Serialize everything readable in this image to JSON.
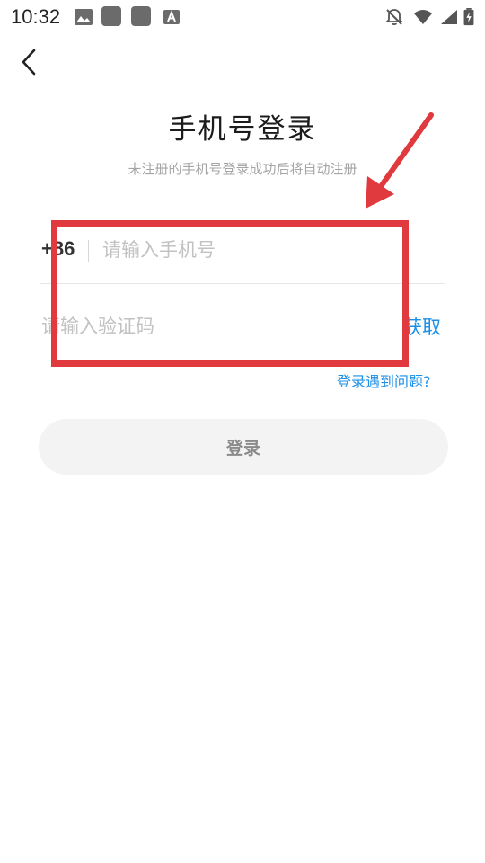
{
  "status_bar": {
    "time": "10:32",
    "left_icons": [
      "image-icon",
      "app-square-icon",
      "app-square-icon",
      "keyboard-a-icon"
    ],
    "right_icons": [
      "notifications-off-icon",
      "wifi-icon",
      "signal-icon",
      "battery-charging-icon"
    ]
  },
  "header": {
    "back_icon": "chevron-left-icon",
    "title": "手机号登录",
    "subtitle": "未注册的手机号登录成功后将自动注册"
  },
  "form": {
    "country_code": "+86",
    "phone_placeholder": "请输入手机号",
    "phone_value": "",
    "code_placeholder": "请输入验证码",
    "code_value": "",
    "get_code_label": "获取",
    "help_link": "登录遇到问题?",
    "login_label": "登录"
  },
  "annotation": {
    "color": "#e0393e",
    "shape": "rectangle-with-arrow"
  },
  "colors": {
    "accent": "#1a8fe8",
    "title": "#1c1c1c",
    "placeholder": "#c2c2c2",
    "login_button_bg": "#f3f3f3"
  }
}
